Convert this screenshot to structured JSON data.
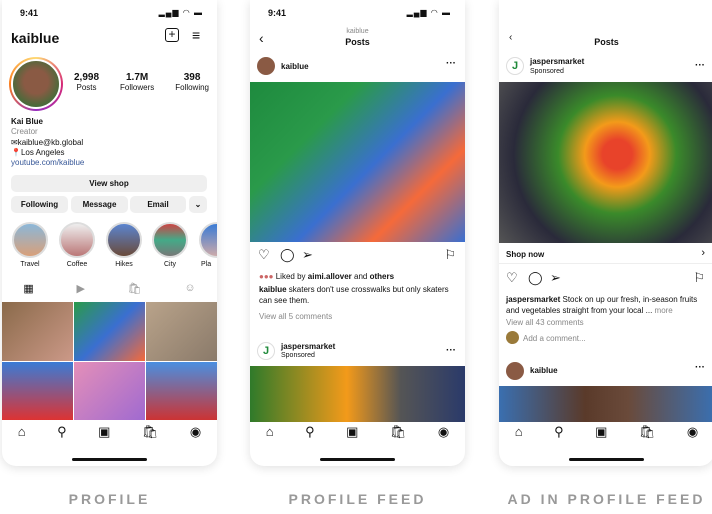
{
  "status_time": "9:41",
  "profile": {
    "username": "kaiblue",
    "stats": [
      {
        "value": "2,998",
        "label": "Posts"
      },
      {
        "value": "1.7M",
        "label": "Followers"
      },
      {
        "value": "398",
        "label": "Following"
      }
    ],
    "name": "Kai Blue",
    "category": "Creator",
    "email": "kaiblue@kb.global",
    "location": "Los Angeles",
    "link": "youtube.com/kaiblue",
    "view_shop": "View shop",
    "following": "Following",
    "message": "Message",
    "email_btn": "Email",
    "highlights": [
      "Travel",
      "Coffee",
      "Hikes",
      "City",
      "Pla"
    ]
  },
  "feed": {
    "header_user": "kaiblue",
    "header_title": "Posts",
    "post_user": "kaiblue",
    "liked_prefix": "Liked by ",
    "liked_user": "aimi.allover",
    "liked_and": " and ",
    "liked_others": "others",
    "caption_user": "kaiblue",
    "caption_text": " skaters don't use crosswalks but only skaters can see them.",
    "view_comments": "View all 5 comments",
    "ad_user": "jaspersmarket",
    "sponsored": "Sponsored"
  },
  "ad": {
    "header_title": "Posts",
    "ad_user": "jaspersmarket",
    "sponsored": "Sponsored",
    "shop_now": "Shop now",
    "caption_user": "jaspersmarket",
    "caption_text": " Stock on up our fresh, in-season fruits and vegetables straight from your local ... ",
    "more": "more",
    "view_comments": "View all 43 comments",
    "add_comment": "Add a comment...",
    "next_user": "kaiblue"
  },
  "labels": [
    "PROFILE",
    "PROFILE FEED",
    "AD IN PROFILE FEED"
  ],
  "colors": {
    "link": "#385898",
    "brand_green": "#1f8a3a",
    "ring": "#d62976"
  }
}
